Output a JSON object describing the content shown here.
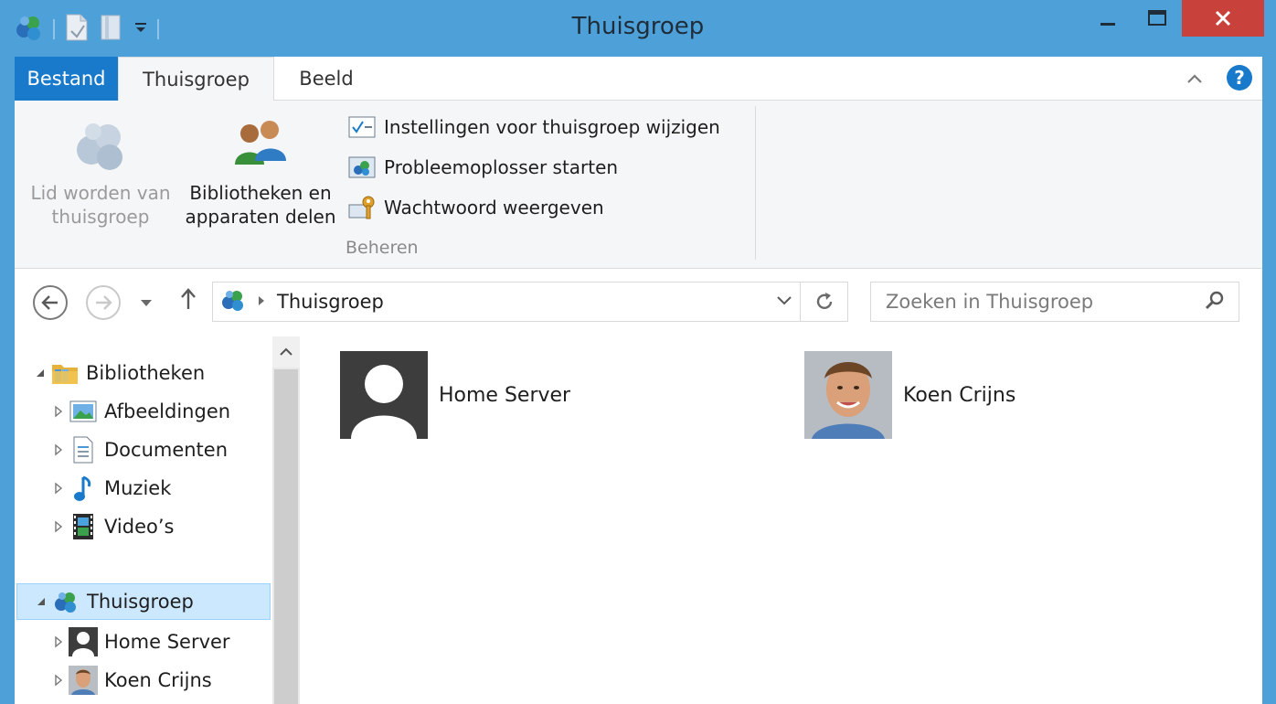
{
  "window": {
    "title": "Thuisgroep"
  },
  "ribbon": {
    "tabs": {
      "file": "Bestand",
      "homegroup": "Thuisgroep",
      "view": "Beeld"
    },
    "join_label_line1": "Lid worden van",
    "join_label_line2": "thuisgroep",
    "share_label_line1": "Bibliotheken en",
    "share_label_line2": "apparaten delen",
    "change_settings": "Instellingen voor thuisgroep wijzigen",
    "troubleshooter": "Probleemoplosser starten",
    "show_password": "Wachtwoord weergeven",
    "group_label": "Beheren"
  },
  "address": {
    "path": "Thuisgroep"
  },
  "search": {
    "placeholder": "Zoeken in Thuisgroep"
  },
  "navpane": {
    "libraries": "Bibliotheken",
    "items": {
      "pictures": "Afbeeldingen",
      "documents": "Documenten",
      "music": "Muziek",
      "videos": "Video’s"
    },
    "homegroup": "Thuisgroep",
    "members": {
      "home_server": "Home Server",
      "koen": "Koen Crijns"
    }
  },
  "content": {
    "tiles": {
      "home_server": "Home Server",
      "koen": "Koen Crijns"
    }
  },
  "colors": {
    "titlebar": "#4ea0d9",
    "file_tab": "#1979ca",
    "close_button": "#c8413b",
    "selection": "#cce8ff"
  }
}
